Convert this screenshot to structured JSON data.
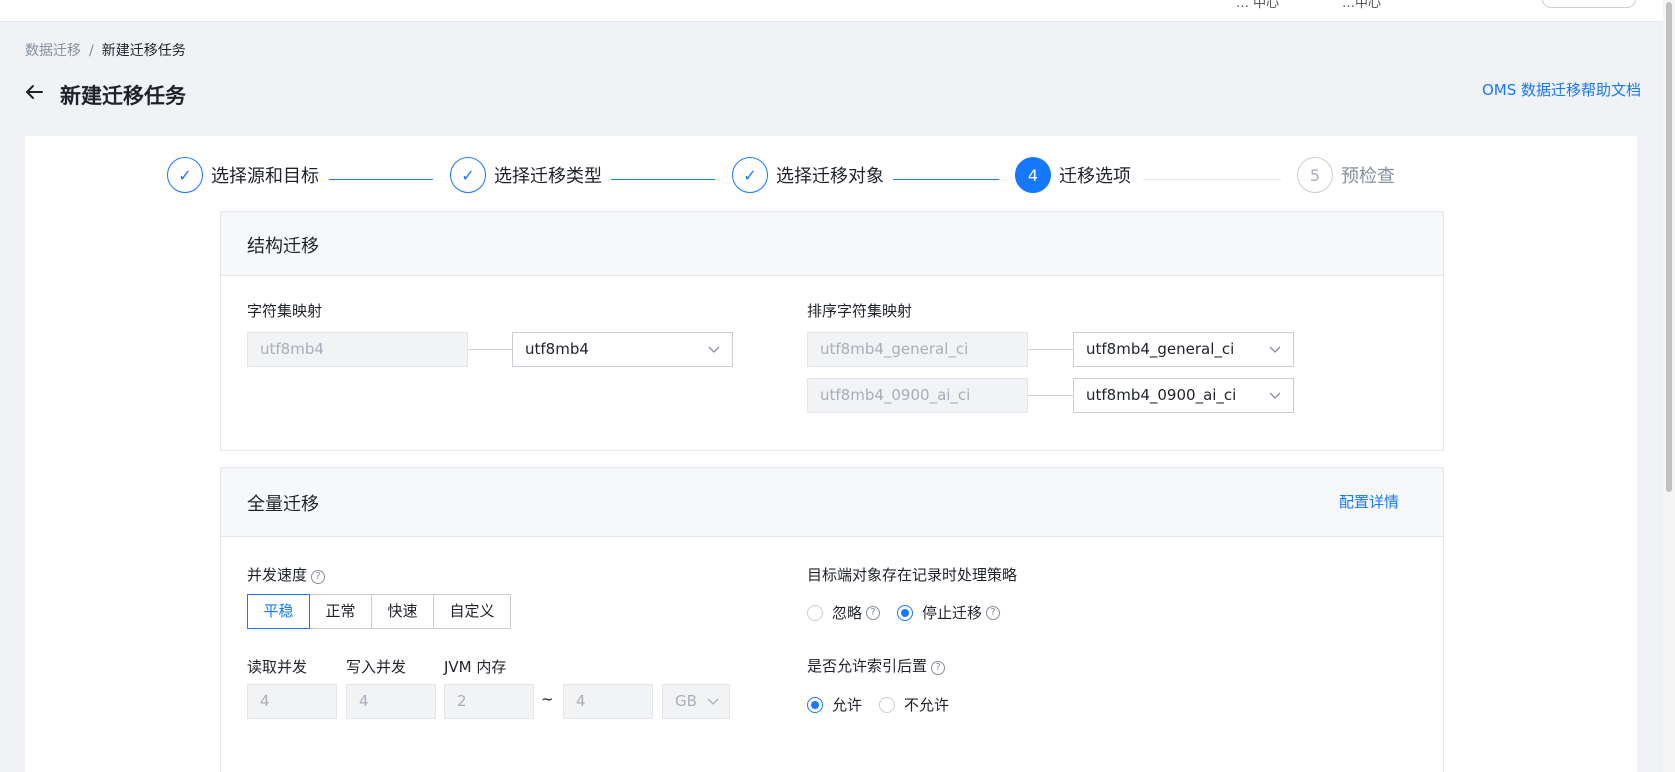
{
  "topbar": {
    "item1": "… 中心",
    "item2": "…中心",
    "pill": ""
  },
  "breadcrumb": {
    "root": "数据迁移",
    "sep": "/",
    "current": "新建迁移任务"
  },
  "header": {
    "title": "新建迁移任务",
    "help_link": "OMS 数据迁移帮助文档"
  },
  "steps": [
    {
      "num": "✓",
      "label": "选择源和目标",
      "state": "done"
    },
    {
      "num": "✓",
      "label": "选择迁移类型",
      "state": "done"
    },
    {
      "num": "✓",
      "label": "选择迁移对象",
      "state": "done"
    },
    {
      "num": "4",
      "label": "迁移选项",
      "state": "active"
    },
    {
      "num": "5",
      "label": "预检查",
      "state": "todo"
    }
  ],
  "structure": {
    "title": "结构迁移",
    "charset_label": "字符集映射",
    "charset_source": "utf8mb4",
    "charset_target": "utf8mb4",
    "collation_label": "排序字符集映射",
    "collations": [
      {
        "source": "utf8mb4_general_ci",
        "target": "utf8mb4_general_ci"
      },
      {
        "source": "utf8mb4_0900_ai_ci",
        "target": "utf8mb4_0900_ai_ci"
      }
    ]
  },
  "full": {
    "title": "全量迁移",
    "config_link": "配置详情",
    "speed_label": "并发速度",
    "speed_options": [
      "平稳",
      "正常",
      "快速",
      "自定义"
    ],
    "speed_selected": "平稳",
    "read_label": "读取并发",
    "write_label": "写入并发",
    "jvm_label": "JVM 内存",
    "read_value": "4",
    "write_value": "4",
    "jvm_min": "2",
    "range_sep": "~",
    "jvm_max": "4",
    "unit": "GB",
    "policy_label": "目标端对象存在记录时处理策略",
    "policy_options": [
      "忽略",
      "停止迁移"
    ],
    "policy_selected": "停止迁移",
    "index_label": "是否允许索引后置",
    "index_options": [
      "允许",
      "不允许"
    ],
    "index_selected": "允许"
  },
  "colors": {
    "primary": "#1677ff",
    "bg": "#f0f2f5",
    "border": "#e5e6eb"
  }
}
